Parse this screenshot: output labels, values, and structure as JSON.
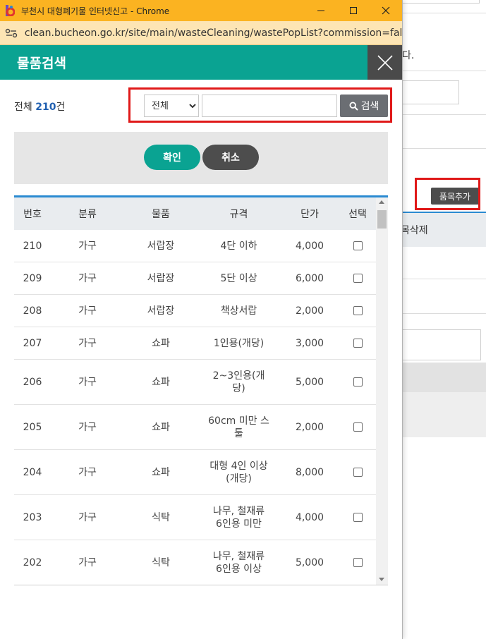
{
  "window": {
    "title": "부천시 대형폐기물 인터넷신고 - Chrome",
    "url": "clean.bucheon.go.kr/site/main/wasteCleaning/wastePopList?commission=false..."
  },
  "popup": {
    "title": "물품검색",
    "total_prefix": "전체 ",
    "total_count": "210",
    "total_suffix": "건",
    "category_selected": "전체",
    "search_button": "검색",
    "confirm_button": "확인",
    "cancel_button": "취소",
    "columns": [
      "번호",
      "분류",
      "물품",
      "규격",
      "단가",
      "선택"
    ],
    "rows": [
      {
        "no": "210",
        "category": "가구",
        "item": "서랍장",
        "spec": "4단 이하",
        "price": "4,000"
      },
      {
        "no": "209",
        "category": "가구",
        "item": "서랍장",
        "spec": "5단 이상",
        "price": "6,000"
      },
      {
        "no": "208",
        "category": "가구",
        "item": "서랍장",
        "spec": "책상서랍",
        "price": "2,000"
      },
      {
        "no": "207",
        "category": "가구",
        "item": "쇼파",
        "spec": "1인용(개당)",
        "price": "3,000"
      },
      {
        "no": "206",
        "category": "가구",
        "item": "쇼파",
        "spec": "2~3인용(개\n당)",
        "price": "5,000"
      },
      {
        "no": "205",
        "category": "가구",
        "item": "쇼파",
        "spec": "60cm 미만 스\n툴",
        "price": "2,000"
      },
      {
        "no": "204",
        "category": "가구",
        "item": "쇼파",
        "spec": "대형 4인 이상\n(개당)",
        "price": "8,000"
      },
      {
        "no": "203",
        "category": "가구",
        "item": "식탁",
        "spec": "나무, 철재류\n6인용 미만",
        "price": "4,000"
      },
      {
        "no": "202",
        "category": "가구",
        "item": "식탁",
        "spec": "나무, 철재류\n6인용 이상",
        "price": "5,000"
      }
    ]
  },
  "background": {
    "partial_text_1": "다.",
    "add_item_button": "품목추가",
    "table_header_partial": "목삭제"
  },
  "colors": {
    "teal": "#0aa392",
    "titlebar": "#fbb321",
    "highlight_red": "#e01919",
    "table_top_border": "#2a8ad1"
  }
}
